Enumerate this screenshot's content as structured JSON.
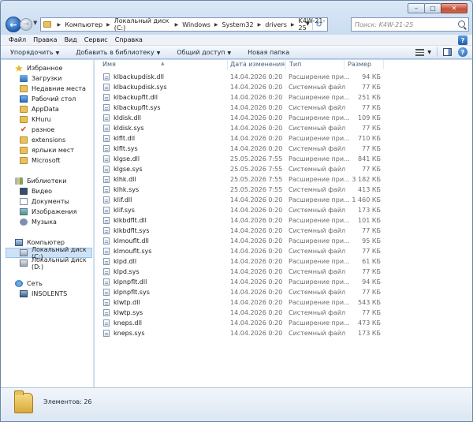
{
  "window": {
    "caption": {
      "minimize": "–",
      "maximize": "□",
      "close": "✕"
    }
  },
  "address": {
    "crumbs": [
      "Компьютер",
      "Локальный диск (C:)",
      "Windows",
      "System32",
      "drivers",
      "K4W-21-25"
    ]
  },
  "search": {
    "placeholder": "Поиск: K4W-21-25"
  },
  "menubar": {
    "items": [
      "Файл",
      "Правка",
      "Вид",
      "Сервис",
      "Справка"
    ]
  },
  "toolbar": {
    "organize": "Упорядочить",
    "add_to_library": "Добавить в библиотеку",
    "share": "Общий доступ",
    "new_folder": "Новая папка"
  },
  "navpane": {
    "favorites": {
      "label": "Избранное",
      "items": [
        "Загрузки",
        "Недавние места",
        "Рабочий стол",
        "AppData",
        "KHuru",
        "разное",
        "extensions",
        "ярлыки мест",
        "Microsoft"
      ]
    },
    "libraries": {
      "label": "Библиотеки",
      "items": [
        "Видео",
        "Документы",
        "Изображения",
        "Музыка"
      ]
    },
    "computer": {
      "label": "Компьютер",
      "items": [
        "Локальный диск (C:)",
        "Локальный диск (D:)"
      ]
    },
    "network": {
      "label": "Сеть",
      "items": [
        "INSOLENTS"
      ]
    }
  },
  "columns": {
    "name": "Имя",
    "date": "Дата изменения",
    "type": "Тип",
    "size": "Размер"
  },
  "files": [
    {
      "name": "klbackupdisk.dll",
      "date": "14.04.2026 0:20",
      "type": "Расширение при...",
      "size": "94 КБ"
    },
    {
      "name": "klbackupdisk.sys",
      "date": "14.04.2026 0:20",
      "type": "Системный файл",
      "size": "77 КБ"
    },
    {
      "name": "klbackupflt.dll",
      "date": "14.04.2026 0:20",
      "type": "Расширение при...",
      "size": "251 КБ"
    },
    {
      "name": "klbackupflt.sys",
      "date": "14.04.2026 0:20",
      "type": "Системный файл",
      "size": "77 КБ"
    },
    {
      "name": "kldisk.dll",
      "date": "14.04.2026 0:20",
      "type": "Расширение при...",
      "size": "109 КБ"
    },
    {
      "name": "kldisk.sys",
      "date": "14.04.2026 0:20",
      "type": "Системный файл",
      "size": "77 КБ"
    },
    {
      "name": "klflt.dll",
      "date": "14.04.2026 0:20",
      "type": "Расширение при...",
      "size": "710 КБ"
    },
    {
      "name": "klflt.sys",
      "date": "14.04.2026 0:20",
      "type": "Системный файл",
      "size": "77 КБ"
    },
    {
      "name": "klgse.dll",
      "date": "25.05.2026 7:55",
      "type": "Расширение при...",
      "size": "841 КБ"
    },
    {
      "name": "klgse.sys",
      "date": "25.05.2026 7:55",
      "type": "Системный файл",
      "size": "77 КБ"
    },
    {
      "name": "klhk.dll",
      "date": "25.05.2026 7:55",
      "type": "Расширение при...",
      "size": "3 182 КБ"
    },
    {
      "name": "klhk.sys",
      "date": "25.05.2026 7:55",
      "type": "Системный файл",
      "size": "413 КБ"
    },
    {
      "name": "klif.dll",
      "date": "14.04.2026 0:20",
      "type": "Расширение при...",
      "size": "1 460 КБ"
    },
    {
      "name": "klif.sys",
      "date": "14.04.2026 0:20",
      "type": "Системный файл",
      "size": "173 КБ"
    },
    {
      "name": "klkbdflt.dll",
      "date": "14.04.2026 0:20",
      "type": "Расширение при...",
      "size": "101 КБ"
    },
    {
      "name": "klkbdflt.sys",
      "date": "14.04.2026 0:20",
      "type": "Системный файл",
      "size": "77 КБ"
    },
    {
      "name": "klmouflt.dll",
      "date": "14.04.2026 0:20",
      "type": "Расширение при...",
      "size": "95 КБ"
    },
    {
      "name": "klmouflt.sys",
      "date": "14.04.2026 0:20",
      "type": "Системный файл",
      "size": "77 КБ"
    },
    {
      "name": "klpd.dll",
      "date": "14.04.2026 0:20",
      "type": "Расширение при...",
      "size": "61 КБ"
    },
    {
      "name": "klpd.sys",
      "date": "14.04.2026 0:20",
      "type": "Системный файл",
      "size": "77 КБ"
    },
    {
      "name": "klpnpflt.dll",
      "date": "14.04.2026 0:20",
      "type": "Расширение при...",
      "size": "94 КБ"
    },
    {
      "name": "klpnpflt.sys",
      "date": "14.04.2026 0:20",
      "type": "Системный файл",
      "size": "77 КБ"
    },
    {
      "name": "klwtp.dll",
      "date": "14.04.2026 0:20",
      "type": "Расширение при...",
      "size": "543 КБ"
    },
    {
      "name": "klwtp.sys",
      "date": "14.04.2026 0:20",
      "type": "Системный файл",
      "size": "77 КБ"
    },
    {
      "name": "kneps.dll",
      "date": "14.04.2026 0:20",
      "type": "Расширение при...",
      "size": "473 КБ"
    },
    {
      "name": "kneps.sys",
      "date": "14.04.2026 0:20",
      "type": "Системный файл",
      "size": "173 КБ"
    }
  ],
  "status": {
    "text": "Элементов: 26"
  }
}
